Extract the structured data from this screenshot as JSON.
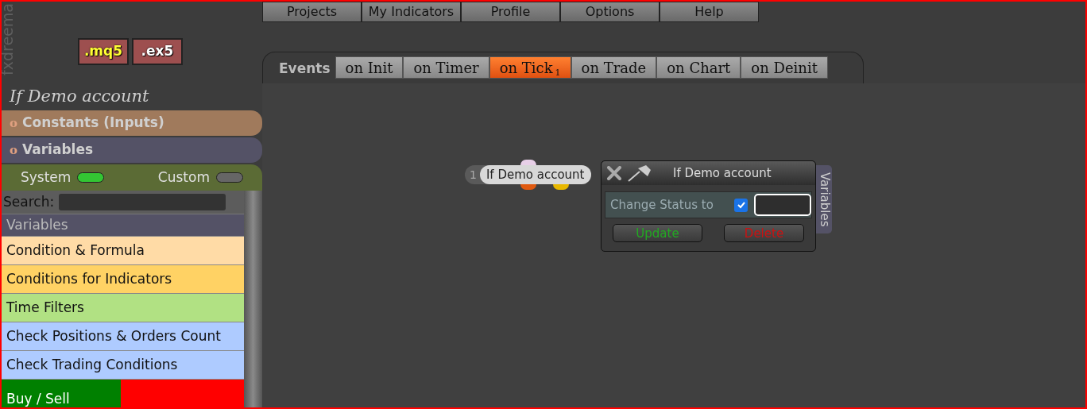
{
  "menu": [
    {
      "label": "Projects"
    },
    {
      "label": "My Indicators"
    },
    {
      "label": "Profile"
    },
    {
      "label": "Options"
    },
    {
      "label": "Help"
    }
  ],
  "brand": "fxdreema",
  "file_buttons": [
    {
      "label": ".mq5",
      "kind": "source"
    },
    {
      "label": ".ex5",
      "kind": "compiled"
    }
  ],
  "block_title": "If Demo account",
  "sections": [
    {
      "marker": "o",
      "label": "Constants (Inputs)",
      "color": "#a07a5c"
    },
    {
      "marker": "o",
      "label": "Variables",
      "color": "#545266"
    }
  ],
  "toggles": [
    {
      "label": "System",
      "on": true
    },
    {
      "label": "Custom",
      "on": false
    }
  ],
  "search": {
    "label": "Search:"
  },
  "list_header": "Variables",
  "categories": [
    {
      "label": "Condition & Formula",
      "kind": "plain",
      "color": "#ffdba6"
    },
    {
      "label": "Conditions for Indicators",
      "kind": "plain",
      "color": "#ffd264"
    },
    {
      "label": "Time Filters",
      "kind": "plain",
      "color": "#b1e183"
    },
    {
      "label": "Check Positions & Orders Count",
      "kind": "plain",
      "color": "#aecbff"
    },
    {
      "label": "Check Trading Conditions",
      "kind": "plain",
      "color": "#aecbff"
    },
    {
      "label": "Buy / Sell",
      "kind": "split",
      "color": "#008000"
    }
  ],
  "events": {
    "label": "Events",
    "tabs": [
      {
        "label": "on Init",
        "selected": false
      },
      {
        "label": "on Timer",
        "selected": false
      },
      {
        "label": "on Tick",
        "badge": "1",
        "selected": true
      },
      {
        "label": "on Trade",
        "selected": false
      },
      {
        "label": "on Chart",
        "selected": false
      },
      {
        "label": "on Deinit",
        "selected": false
      }
    ]
  },
  "node": {
    "number": "1",
    "label": "If Demo account"
  },
  "dialog": {
    "title": "If Demo account",
    "row_label": "Change Status to",
    "checked": true,
    "buttons": [
      {
        "label": "Update",
        "kind": "ok"
      },
      {
        "label": "Delete",
        "kind": "danger"
      }
    ],
    "side_tab": "Variables"
  }
}
